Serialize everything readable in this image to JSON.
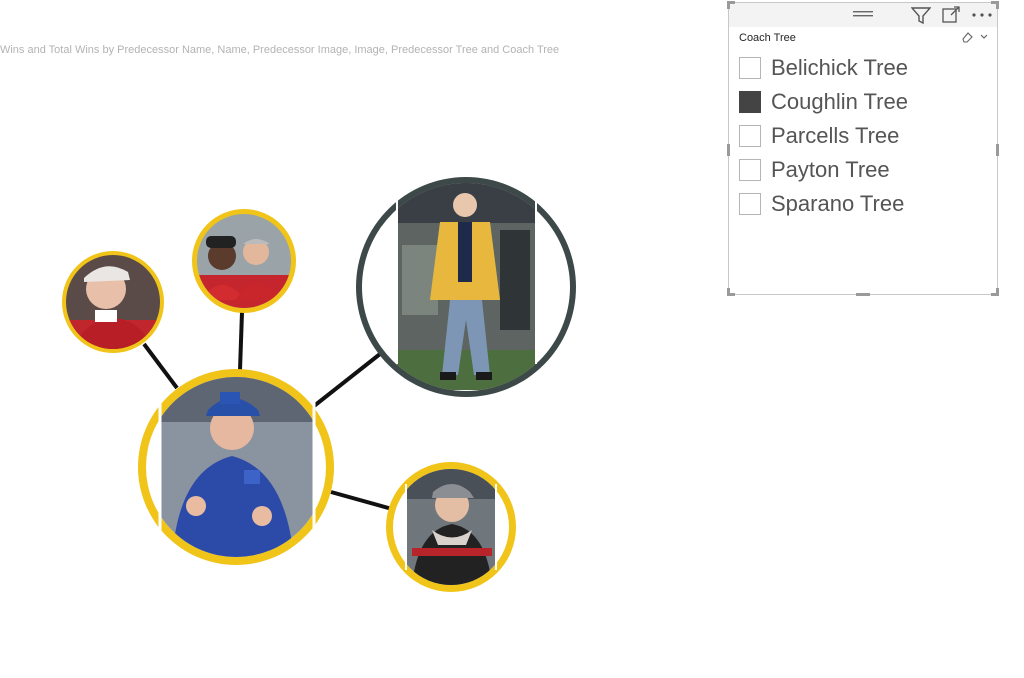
{
  "visual": {
    "title": "essor Wins and Total Wins by Predecessor Name, Name, Predecessor Image, Image, Predecessor Tree and Coach Tree"
  },
  "graph": {
    "nodes": [
      {
        "id": "coughlin",
        "name": "coughlin-node",
        "ring_color": "#f0c419",
        "photo": "coach-blue-hoodie"
      },
      {
        "id": "top-left",
        "name": "predecessor-node-red-jacket",
        "ring_color": "#f0c419",
        "photo": "coach-red-jacket"
      },
      {
        "id": "top-mid",
        "name": "predecessor-node-two-coaches",
        "ring_color": "#f0c419",
        "photo": "two-coaches-red"
      },
      {
        "id": "top-right",
        "name": "predecessor-node-gold-jacket",
        "ring_color": "#3d4848",
        "photo": "coach-gold-jacket"
      },
      {
        "id": "bottom-right",
        "name": "predecessor-node-bills",
        "ring_color": "#f0c419",
        "photo": "coach-bills-cap"
      }
    ],
    "edge_color": "#111111"
  },
  "slicer": {
    "title": "Coach Tree",
    "header_icons": [
      "drag-handle-icon",
      "filter-icon",
      "focus-mode-icon",
      "more-options-icon"
    ],
    "tools": [
      "eraser-icon",
      "chevron-down-icon"
    ],
    "items": [
      {
        "label": "Belichick Tree",
        "checked": false
      },
      {
        "label": "Coughlin Tree",
        "checked": true
      },
      {
        "label": "Parcells Tree",
        "checked": false
      },
      {
        "label": "Payton Tree",
        "checked": false
      },
      {
        "label": "Sparano Tree",
        "checked": false
      }
    ]
  }
}
